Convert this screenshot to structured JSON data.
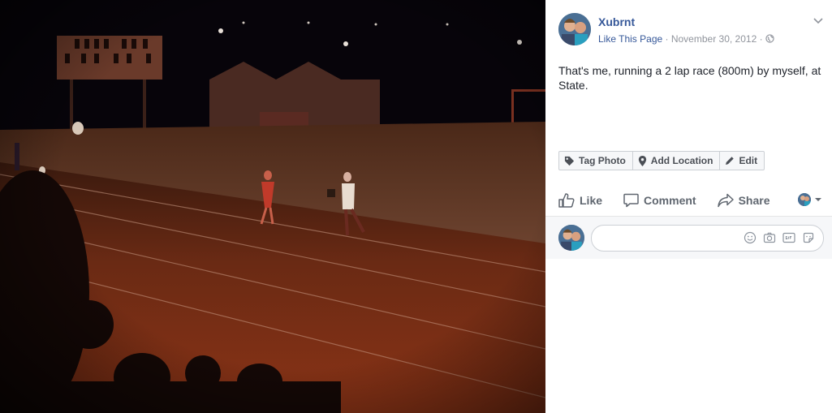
{
  "post": {
    "page_name": "Xubrnt",
    "like_page": "Like This Page",
    "separator": " · ",
    "date": "November 30, 2012",
    "caption": "That's me, running a 2 lap race (800m) by myself, at State."
  },
  "photo_actions": {
    "tag_photo": "Tag Photo",
    "add_location": "Add Location",
    "edit": "Edit"
  },
  "ufi": {
    "like": "Like",
    "comment": "Comment",
    "share": "Share"
  },
  "comment_box": {
    "placeholder": ""
  },
  "icons": [
    "chevron-down-icon",
    "globe-icon",
    "tag-icon",
    "location-pin-icon",
    "pencil-icon",
    "thumbs-up-icon",
    "comment-bubble-icon",
    "share-arrow-icon",
    "smiley-icon",
    "camera-icon",
    "gif-icon",
    "sticker-icon"
  ],
  "colors": {
    "link": "#365899",
    "meta": "#90949c",
    "text": "#1d2129",
    "button_bg": "#f6f7f9",
    "border": "#ccd0d5"
  }
}
